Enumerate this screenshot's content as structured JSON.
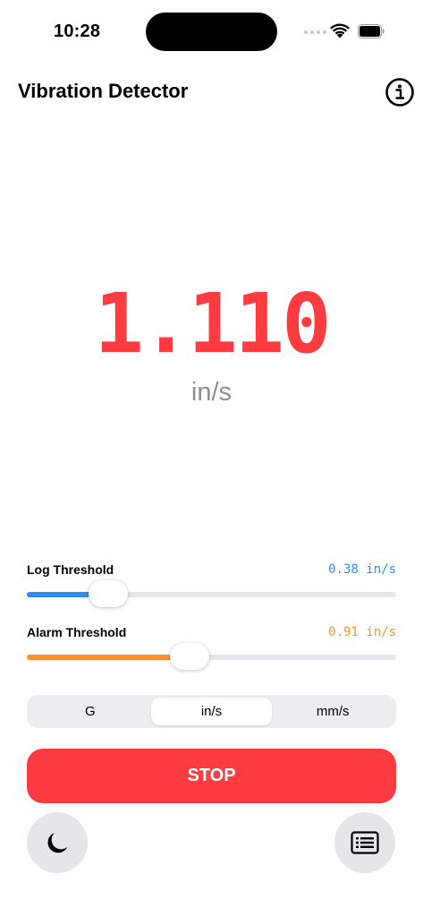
{
  "status_bar": {
    "time": "10:28"
  },
  "header": {
    "title": "Vibration Detector"
  },
  "reading": {
    "value": "1.110",
    "unit": "in/s"
  },
  "log_threshold": {
    "label": "Log Threshold",
    "value_text": "0.38 in/s",
    "fraction": 0.22,
    "color": "#2f8cf5"
  },
  "alarm_threshold": {
    "label": "Alarm Threshold",
    "value_text": "0.91 in/s",
    "fraction": 0.44,
    "color": "#fb9230"
  },
  "units": {
    "options": [
      "G",
      "in/s",
      "mm/s"
    ],
    "selected": "in/s"
  },
  "stop_button": {
    "label": "STOP",
    "color": "#fc3c41"
  },
  "icons": {
    "info": "info-icon",
    "dark_mode": "moon-icon",
    "log": "list-icon"
  }
}
